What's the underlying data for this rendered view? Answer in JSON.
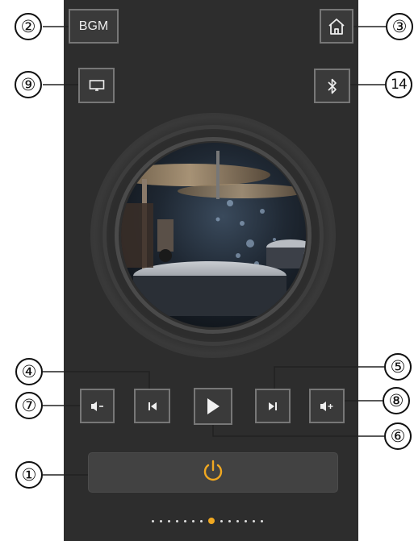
{
  "header": {
    "bgm_label": "BGM",
    "home_icon": "home-icon",
    "screen_icon": "screen-cast-icon",
    "bluetooth_icon": "bluetooth-icon"
  },
  "album_art": {
    "subject": "drum-kit-cymbals-photo"
  },
  "controls": {
    "volume_down_icon": "volume-down-icon",
    "previous_icon": "previous-track-icon",
    "play_icon": "play-icon",
    "next_icon": "next-track-icon",
    "volume_up_icon": "volume-up-icon"
  },
  "power": {
    "icon": "power-icon",
    "accent_color": "#f0a821"
  },
  "pager": {
    "page_count": 14,
    "active_index": 7,
    "active_color": "#f0a821"
  },
  "callouts": {
    "c1": "①",
    "c2": "②",
    "c3": "③",
    "c4": "④",
    "c5": "⑤",
    "c6": "⑥",
    "c7": "⑦",
    "c8": "⑧",
    "c9": "⑨",
    "c14": "14"
  }
}
